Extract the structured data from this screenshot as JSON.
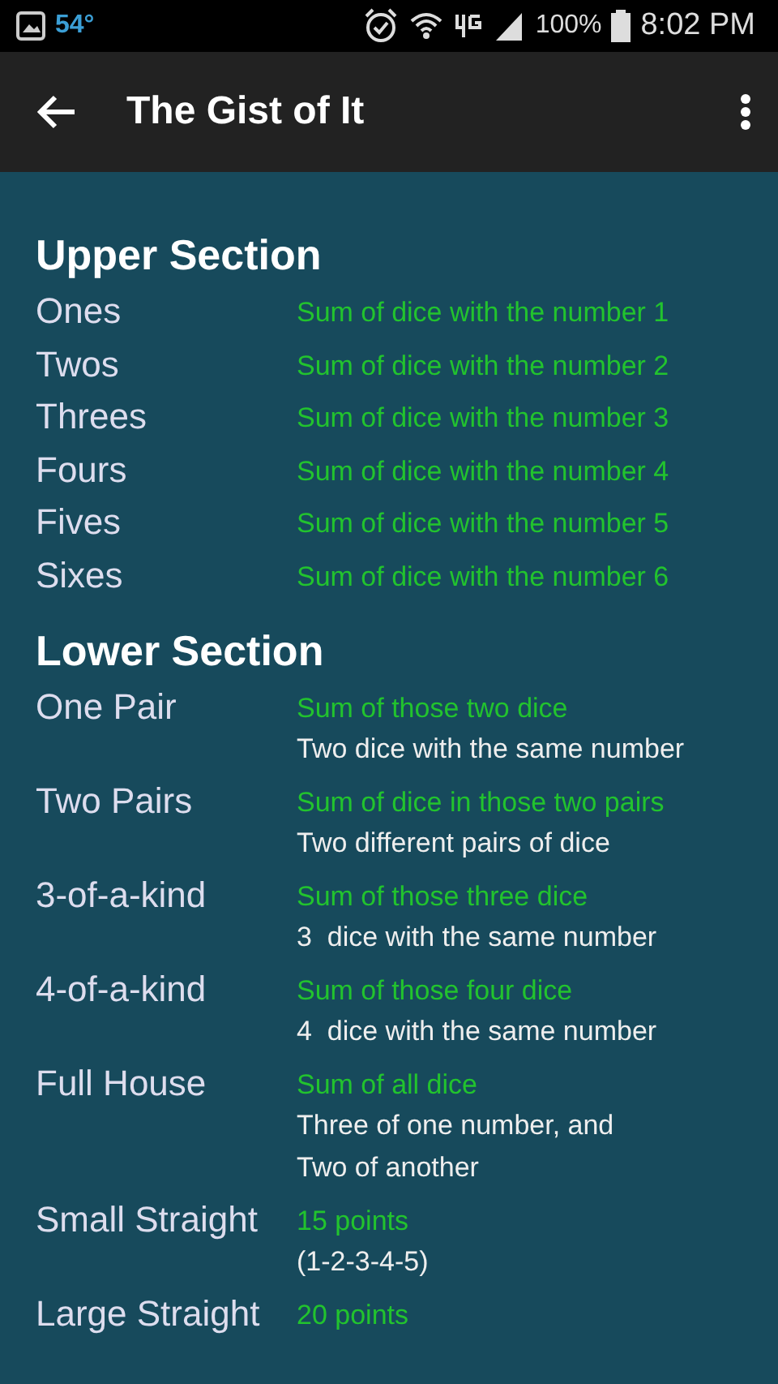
{
  "status_bar": {
    "temperature": "54°",
    "battery": "100%",
    "time": "8:02 PM"
  },
  "app_bar": {
    "title": "The Gist of It"
  },
  "sections": [
    {
      "title": "Upper Section",
      "rows": [
        {
          "label": "Ones",
          "score": "Sum of dice with the number 1",
          "notes": []
        },
        {
          "label": "Twos",
          "score": "Sum of dice with the number 2",
          "notes": []
        },
        {
          "label": "Threes",
          "score": "Sum of dice with the number 3",
          "notes": []
        },
        {
          "label": "Fours",
          "score": "Sum of dice with the number 4",
          "notes": []
        },
        {
          "label": "Fives",
          "score": "Sum of dice with the number 5",
          "notes": []
        },
        {
          "label": "Sixes",
          "score": "Sum of dice with the number 6",
          "notes": []
        }
      ]
    },
    {
      "title": "Lower Section",
      "rows": [
        {
          "label": "One Pair",
          "score": "Sum of those two dice",
          "notes": [
            "Two dice with the same number"
          ]
        },
        {
          "label": "Two Pairs",
          "score": "Sum of dice in those two pairs",
          "notes": [
            "Two different pairs of dice"
          ]
        },
        {
          "label": "3-of-a-kind",
          "score": "Sum of those three dice",
          "notes": [
            "3  dice with the same number"
          ]
        },
        {
          "label": "4-of-a-kind",
          "score": "Sum of those four dice",
          "notes": [
            "4  dice with the same number"
          ]
        },
        {
          "label": "Full House",
          "score": "Sum of all dice",
          "notes": [
            "Three of one number, and",
            "Two of another"
          ]
        },
        {
          "label": "Small Straight",
          "score": "15 points",
          "notes": [
            "(1-2-3-4-5)"
          ]
        },
        {
          "label": "Large Straight",
          "score": "20 points",
          "notes": []
        }
      ]
    }
  ]
}
